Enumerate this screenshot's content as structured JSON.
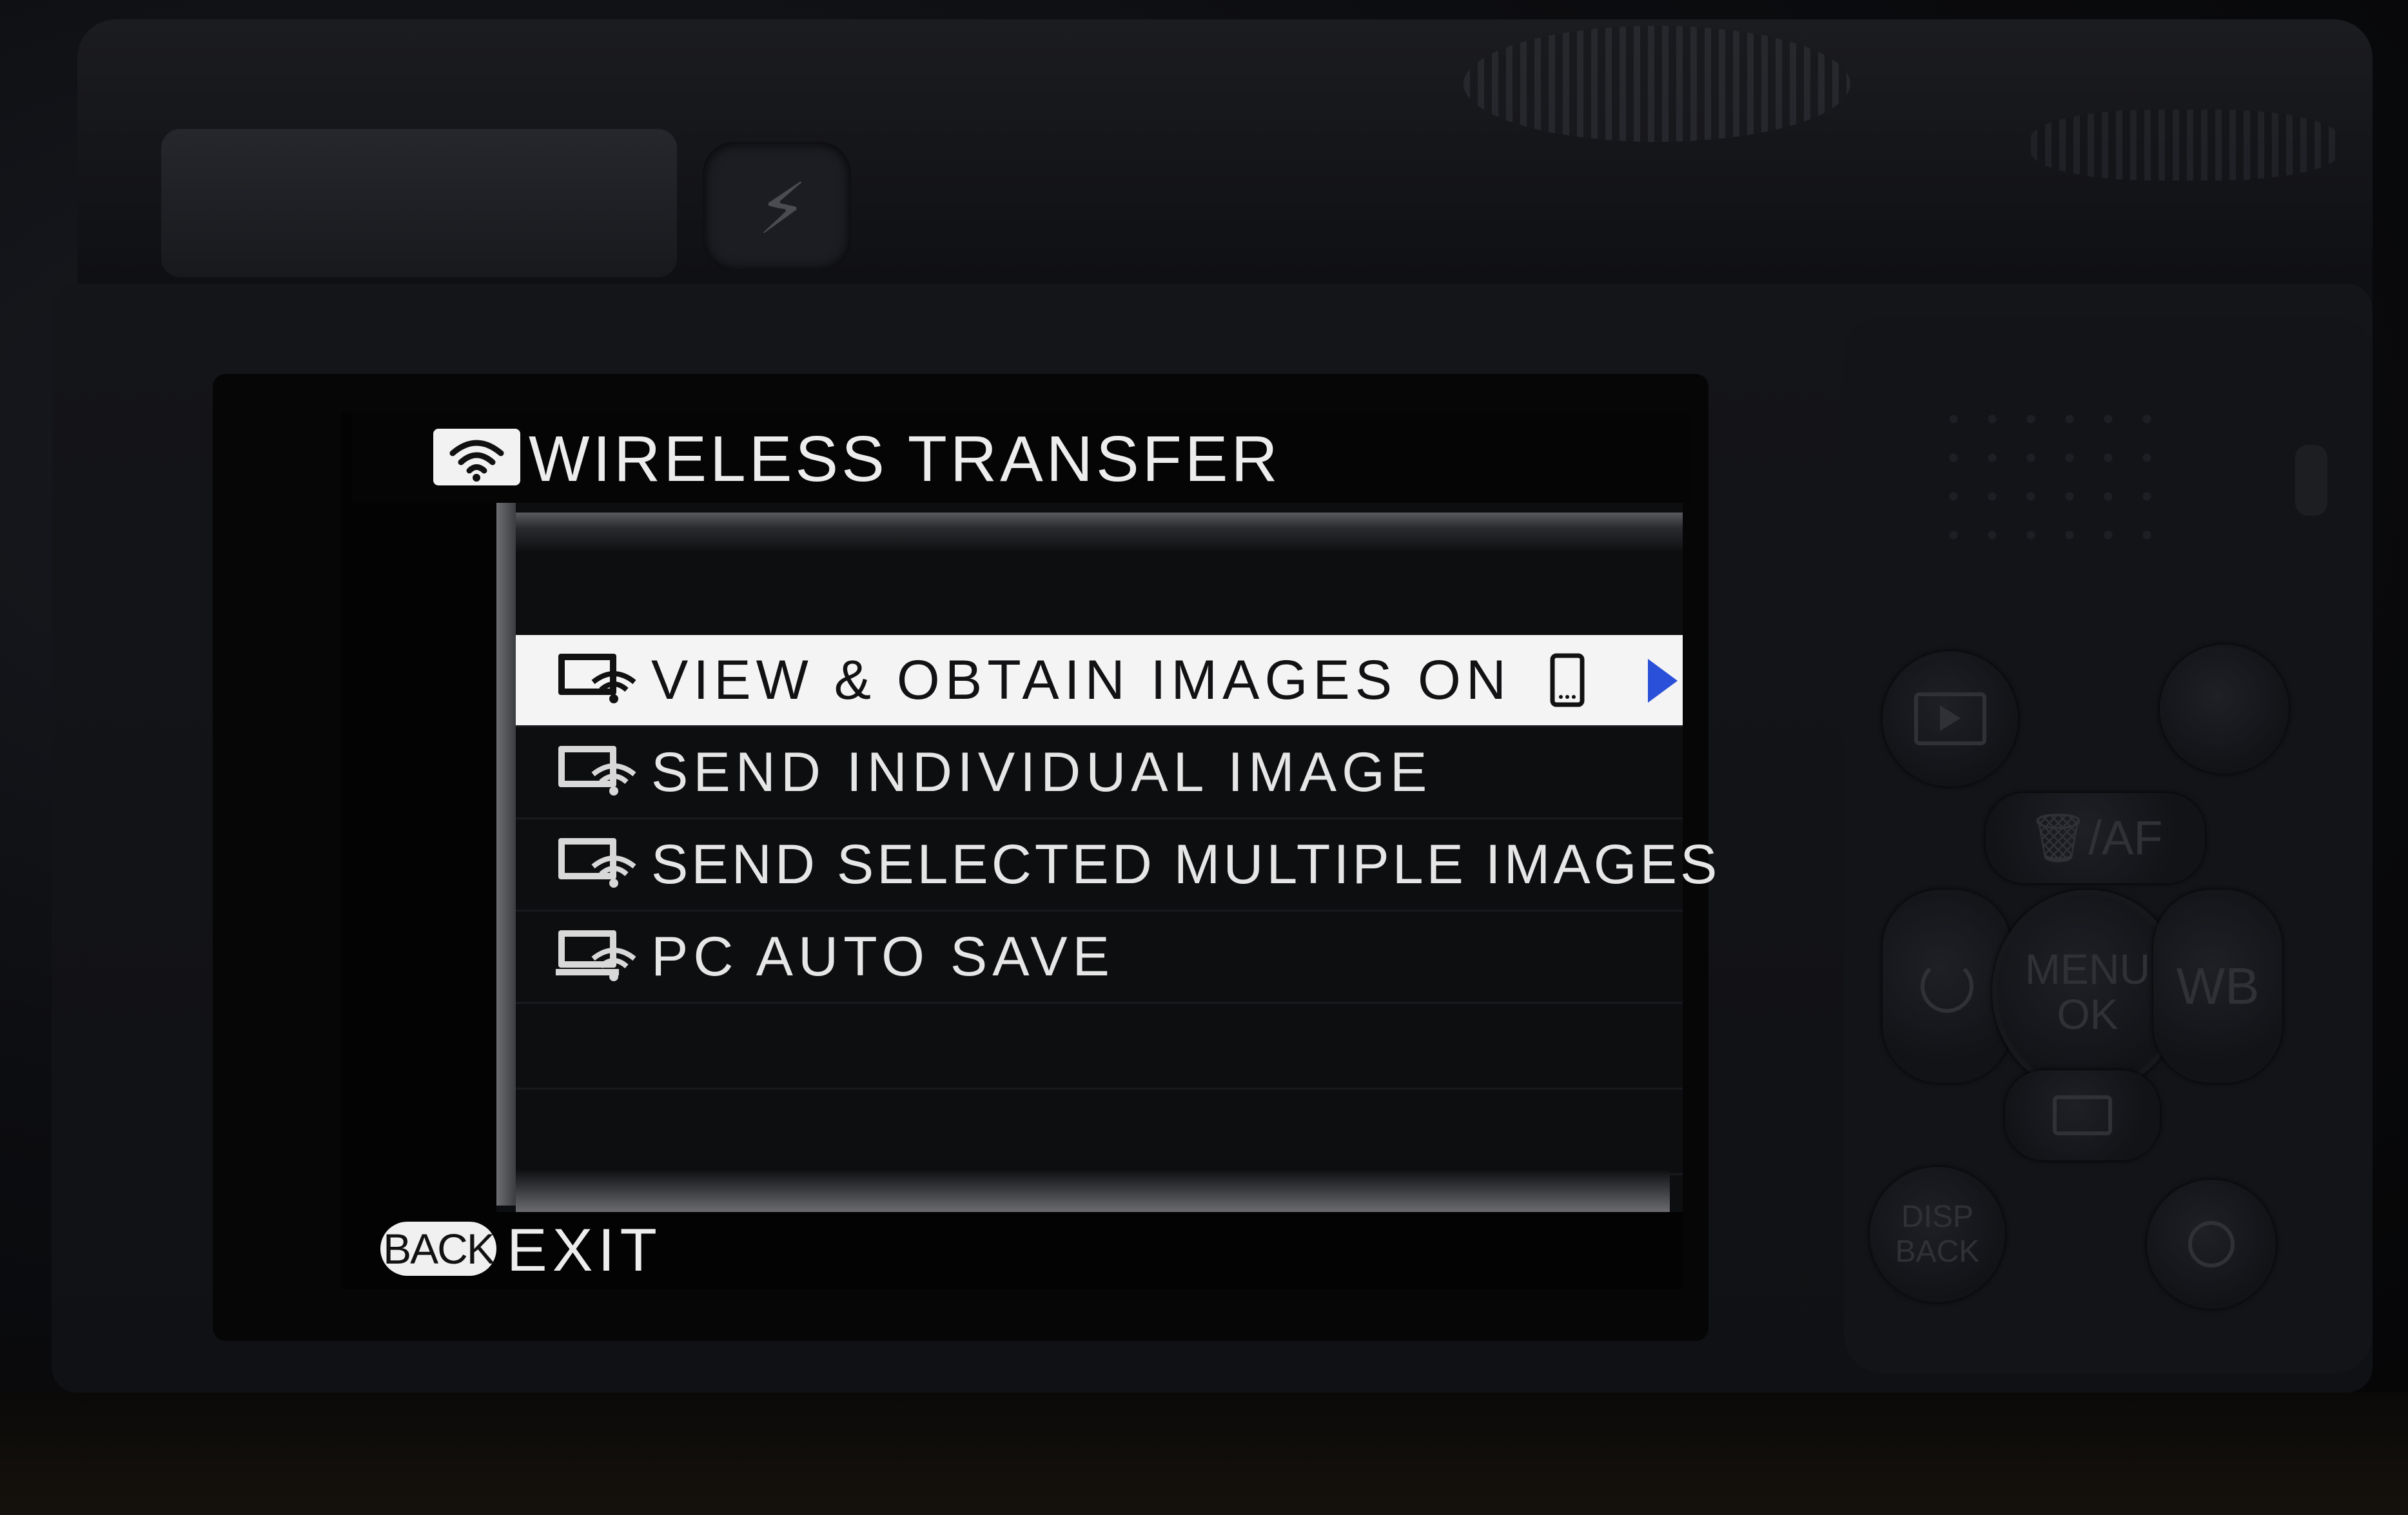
{
  "screen": {
    "title": "WIRELESS TRANSFER",
    "title_icon": "wifi-icon",
    "menu_items": [
      {
        "label": "VIEW & OBTAIN IMAGES ON",
        "icon": "smartphone-wifi-icon",
        "selected": true,
        "trailing_icon": "smartphone-icon",
        "has_submenu": true
      },
      {
        "label": "SEND INDIVIDUAL IMAGE",
        "icon": "send-wifi-icon",
        "selected": false
      },
      {
        "label": "SEND SELECTED MULTIPLE IMAGES",
        "icon": "send-wifi-icon",
        "selected": false
      },
      {
        "label": "PC AUTO SAVE",
        "icon": "pc-wifi-icon",
        "selected": false
      }
    ],
    "footer": {
      "back_button_label": "BACK",
      "exit_label": "EXIT"
    },
    "colors": {
      "highlight_bg": "#f4f4f4",
      "submenu_arrow": "#2a4fd8",
      "text": "#e6e6e6"
    }
  },
  "camera_buttons": {
    "flash_icon": "flash-icon",
    "playback_icon": "playback-icon",
    "delete_af_label": "🗑/AF",
    "menu_ok_label_top": "MENU",
    "menu_ok_label_bottom": "OK",
    "wb_label": "WB",
    "disp_back_label_top": "DISP",
    "disp_back_label_bottom": "BACK",
    "zoom_icon": "magnify-icon",
    "timer_icon": "self-timer-icon",
    "drive_icon": "camera-drive-icon"
  }
}
